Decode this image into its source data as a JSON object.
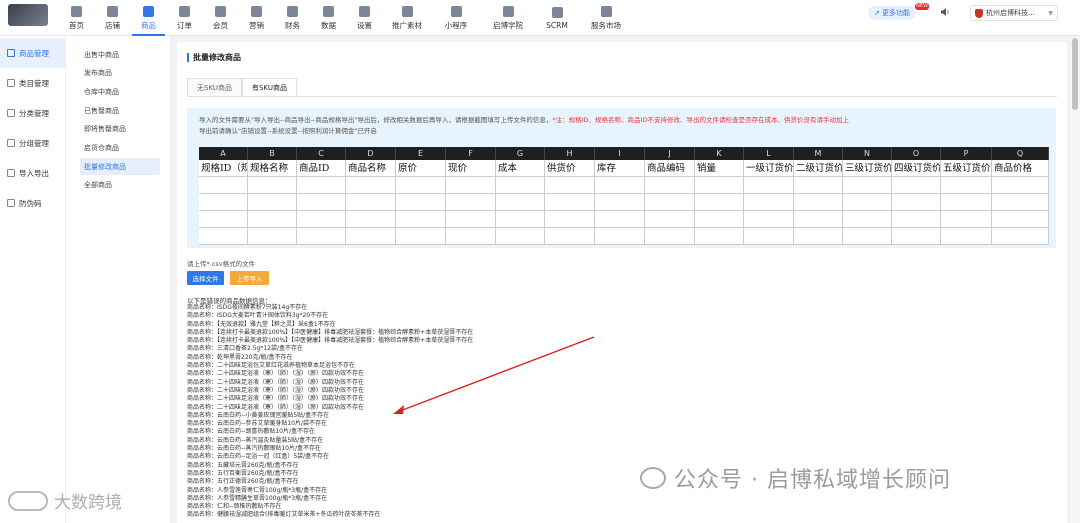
{
  "nav": {
    "items": [
      {
        "label": "首页",
        "icon": "home-icon"
      },
      {
        "label": "店铺",
        "icon": "store-icon"
      },
      {
        "label": "商品",
        "icon": "goods-icon"
      },
      {
        "label": "订单",
        "icon": "order-icon"
      },
      {
        "label": "会员",
        "icon": "member-icon"
      },
      {
        "label": "营销",
        "icon": "marketing-icon"
      },
      {
        "label": "财务",
        "icon": "finance-icon"
      },
      {
        "label": "数据",
        "icon": "data-icon"
      },
      {
        "label": "设置",
        "icon": "settings-icon"
      },
      {
        "label": "推广素材",
        "icon": "share-icon"
      },
      {
        "label": "小程序",
        "icon": "miniapp-icon"
      },
      {
        "label": "启博学院",
        "icon": "academy-icon"
      },
      {
        "label": "SCRM",
        "icon": "scrm-icon"
      },
      {
        "label": "服务市场",
        "icon": "market-icon"
      }
    ],
    "active_index": 2,
    "more_label": "更多功能",
    "new_badge": "NEW",
    "shop_name": "杭州启博科技..."
  },
  "sidebar1": {
    "items": [
      "商品管理",
      "类目管理",
      "分类管理",
      "分组管理",
      "导入导出",
      "防伪码"
    ],
    "active_index": 0
  },
  "sidebar2": {
    "items": [
      "出售中商品",
      "发布商品",
      "仓库中商品",
      "已售罄商品",
      "即将售罄商品",
      "启货仓商品",
      "批量修改商品",
      "全部商品"
    ],
    "active_index": 6
  },
  "main": {
    "title": "批量修改商品",
    "tabs": [
      "无SKU商品",
      "有SKU商品"
    ],
    "active_tab": 1,
    "info_line1": "导入的文件需要从\"导入导出--商品导出--商品规格导出\"导出后，修改相关数据后再导入，请根据截图填写上传文件的信息，",
    "info_warn": "*注：规格ID、规格名称、商品ID不支持修改、导出的文件请检查是否存在成本、供货价没有请手动加上",
    "info_line2": "导出前请确认\"店铺设置--系统设置--按照利润计算佣金\"已开启",
    "excel_cols": [
      "A",
      "B",
      "C",
      "D",
      "E",
      "F",
      "G",
      "H",
      "I",
      "J",
      "K",
      "L",
      "M",
      "N",
      "O",
      "P",
      "Q"
    ],
    "excel_headers": [
      "规格ID（规格名称",
      "规格名称",
      "商品ID",
      "商品名称",
      "原价",
      "现价",
      "成本",
      "供货价",
      "库存",
      "商品编码",
      "销量",
      "一级订货价",
      "二级订货价",
      "三级订货价",
      "四级订货价",
      "五级订货价",
      "商品价格"
    ],
    "upload_note": "请上传*.csv格式的文件",
    "choose_label": "选择文件",
    "upload_label": "上传导入",
    "error_header": "以下是错误的商品数据信息：",
    "error_prefix": "商品名称：",
    "errors": [
      "ISDG夜间酵素粉7只装14g不存在",
      "ISDG大麦若叶青汁固体饮料3g*20不存在",
      "【无效退款】雅九堂【粹之灵】采6盒1不存在",
      "【连续打卡最美退款100%】【中医健康】排毒减肥祛湿套餐：植物综合酵素粉+本草茯湿膏不存在",
      "【连续打卡最美退款100%】【中医健康】排毒减肥祛湿套餐：植物综合酵素粉+本草茯湿膏不存在",
      "三清口香茶2.5g*12袋/盒不存在",
      "乾坤黑膏220克/瓶/盒不存在",
      "二十四味足浴包艾草红花滋养植物草本足浴包不存在",
      "二十四味足浴液（寒）（肺）（湿）（瘀）四款功效不存在",
      "二十四味足浴液（寒）（肺）（湿）（瘀）四款功效不存在",
      "二十四味足浴液（寒）（肺）（湿）（瘀）四款功效不存在",
      "二十四味足浴液（寒）（肺）（湿）（瘀）四款功效不存在",
      "二十四味足浴液（寒）（肺）（湿）（瘀）四款功效不存在",
      "云南白药--小黄姜玫瑰宫暖贴5贴/盒不存在",
      "云南白药--参苏艾草暖身贴10片/袋不存在",
      "云南白药--颈喜热敷贴10片/盒不存在",
      "云南白药--蒸汽温灸贴量装5贴/盒不存在",
      "云南白药--蒸汽热敷眼贴10片/盒不存在",
      "云南白药--足浴一冠（红盒）5袋/盒不存在",
      "五藏培元膏260克/瓶/盒不存在",
      "五行百衡膏260克/瓶/盒不存在",
      "五行正德膏260克/瓶/盒不存在",
      "人参雪莲膏枣仁膏100g/瓶*3瓶/盒不存在",
      "人参雪精膳生草膏100g/瓶*3瓶/盒不存在",
      "仁和--颈椎热敷贴不存在",
      "健腰祛湿减肥组合(排毒暖灯艾草米茶+冬瓜荷叶茯苓茶不存在"
    ]
  },
  "watermark": {
    "right": "公众号 · 启博私域增长顾问",
    "left": "大数跨境"
  },
  "colors": {
    "accent": "#2d78e6",
    "warn": "#e03c3c",
    "upload": "#f4a93a",
    "arrow": "#e02020"
  }
}
